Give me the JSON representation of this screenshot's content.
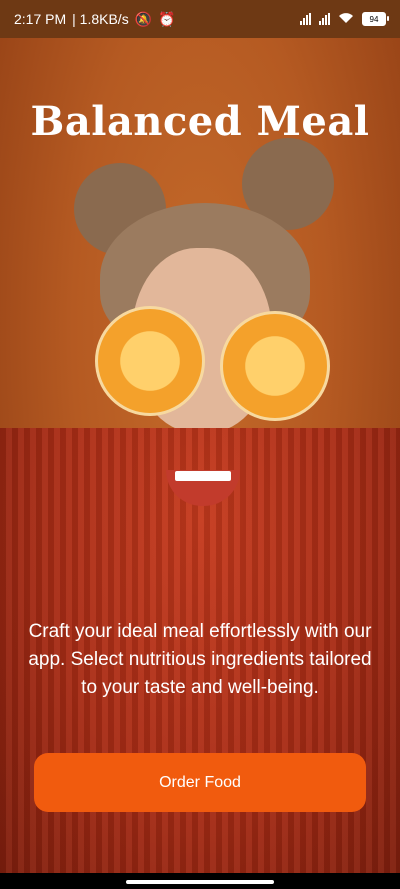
{
  "status_bar": {
    "time": "2:17 PM",
    "speed": "| 1.8KB/s",
    "battery": "94",
    "icons": [
      "mute-bell-icon",
      "alarm-icon",
      "signal-icon",
      "signal-icon",
      "wifi-icon",
      "battery-icon"
    ]
  },
  "hero": {
    "title": "Balanced Meal",
    "description": "Craft your ideal meal effortlessly with our app. Select nutritious ingredients tailored to your taste and well-being.",
    "button_label": "Order Food"
  },
  "colors": {
    "status_bar_bg": "#6e3914",
    "button_bg": "#f15b0e",
    "text": "#ffffff"
  }
}
